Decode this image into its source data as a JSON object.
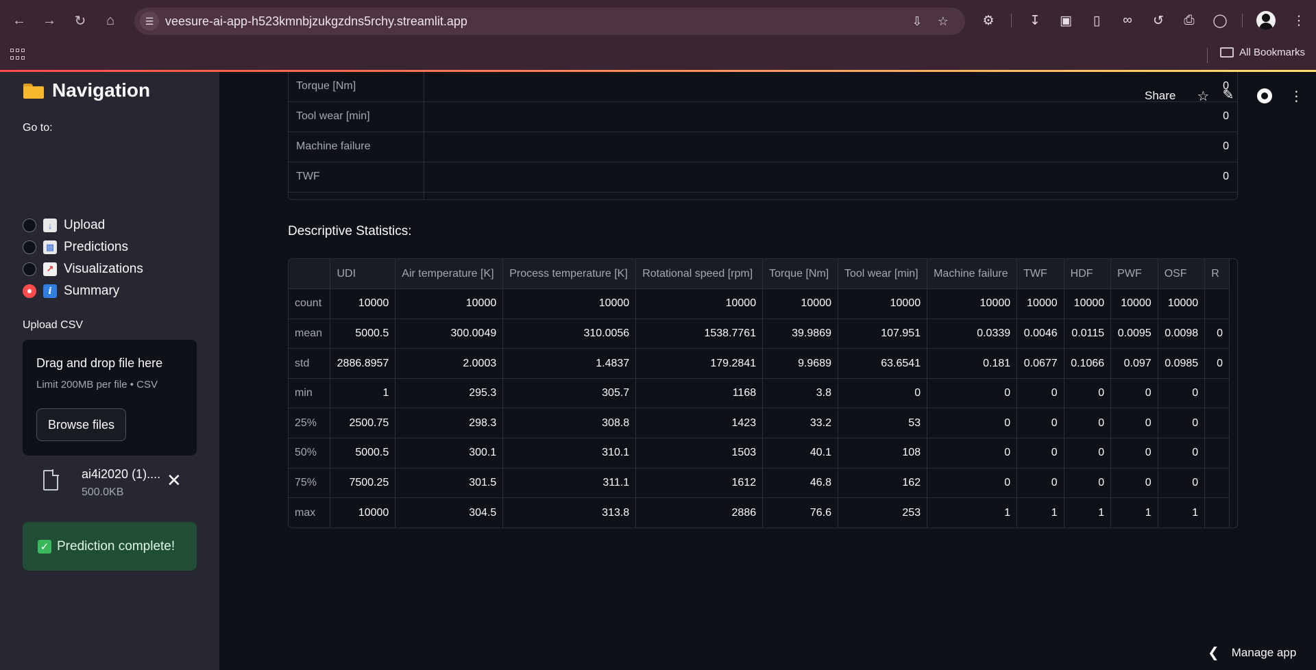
{
  "browser": {
    "url": "veesure-ai-app-h523kmnbjzukgzdns5rchy.streamlit.app",
    "all_bookmarks_label": "All Bookmarks"
  },
  "header": {
    "share_label": "Share"
  },
  "sidebar": {
    "title": "Navigation",
    "goto_label": "Go to:",
    "nav_items": [
      {
        "label": "Upload",
        "icon": "inbox-tray-emoji",
        "checked": false
      },
      {
        "label": "Predictions",
        "icon": "bar-chart-emoji",
        "checked": false
      },
      {
        "label": "Visualizations",
        "icon": "chart-increasing-emoji",
        "checked": false
      },
      {
        "label": "Summary",
        "icon": "information-emoji",
        "checked": true
      }
    ],
    "upload_label": "Upload CSV",
    "dropzone_title": "Drag and drop file here",
    "dropzone_sub": "Limit 200MB per file • CSV",
    "browse_label": "Browse files",
    "file_name": "ai4i2020 (1)....",
    "file_size": "500.0KB",
    "success_message": "Prediction complete!"
  },
  "top_table": {
    "rows": [
      {
        "label": "Torque [Nm]",
        "value": "0"
      },
      {
        "label": "Tool wear [min]",
        "value": "0"
      },
      {
        "label": "Machine failure",
        "value": "0"
      },
      {
        "label": "TWF",
        "value": "0"
      }
    ]
  },
  "stats": {
    "title": "Descriptive Statistics:",
    "columns": [
      "",
      "UDI",
      "Air temperature [K]",
      "Process temperature [K]",
      "Rotational speed [rpm]",
      "Torque [Nm]",
      "Tool wear [min]",
      "Machine failure",
      "TWF",
      "HDF",
      "PWF",
      "OSF",
      "R"
    ],
    "rows": [
      [
        "count",
        "10000",
        "10000",
        "10000",
        "10000",
        "10000",
        "10000",
        "10000",
        "10000",
        "10000",
        "10000",
        "10000",
        ""
      ],
      [
        "mean",
        "5000.5",
        "300.0049",
        "310.0056",
        "1538.7761",
        "39.9869",
        "107.951",
        "0.0339",
        "0.0046",
        "0.0115",
        "0.0095",
        "0.0098",
        "0"
      ],
      [
        "std",
        "2886.8957",
        "2.0003",
        "1.4837",
        "179.2841",
        "9.9689",
        "63.6541",
        "0.181",
        "0.0677",
        "0.1066",
        "0.097",
        "0.0985",
        "0"
      ],
      [
        "min",
        "1",
        "295.3",
        "305.7",
        "1168",
        "3.8",
        "0",
        "0",
        "0",
        "0",
        "0",
        "0",
        ""
      ],
      [
        "25%",
        "2500.75",
        "298.3",
        "308.8",
        "1423",
        "33.2",
        "53",
        "0",
        "0",
        "0",
        "0",
        "0",
        ""
      ],
      [
        "50%",
        "5000.5",
        "300.1",
        "310.1",
        "1503",
        "40.1",
        "108",
        "0",
        "0",
        "0",
        "0",
        "0",
        ""
      ],
      [
        "75%",
        "7500.25",
        "301.5",
        "311.1",
        "1612",
        "46.8",
        "162",
        "0",
        "0",
        "0",
        "0",
        "0",
        ""
      ],
      [
        "max",
        "10000",
        "304.5",
        "313.8",
        "2886",
        "76.6",
        "253",
        "1",
        "1",
        "1",
        "1",
        "1",
        ""
      ]
    ]
  },
  "footer": {
    "manage_app_label": "Manage app"
  },
  "colors": {
    "accent": "#ff4b4b",
    "sidebar_bg": "#262730",
    "main_bg": "#0e1117",
    "success_bg": "#1f4d36"
  }
}
